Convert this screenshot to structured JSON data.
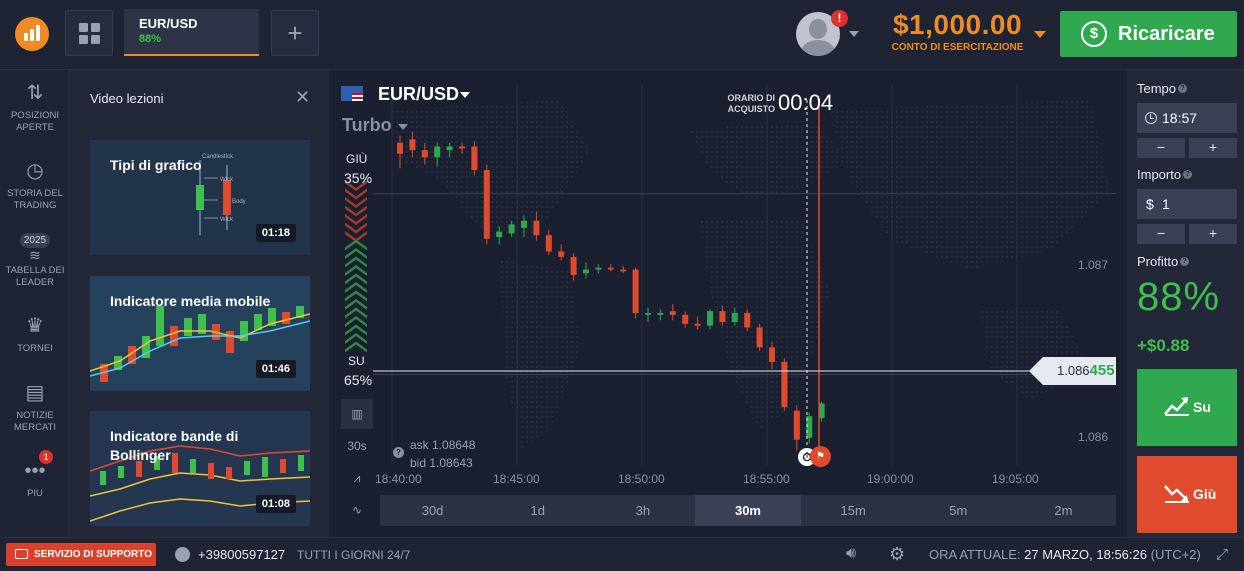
{
  "header": {
    "asset_tab": {
      "name": "EUR/USD",
      "profit": "88%"
    },
    "balance": {
      "amount": "$1,000.00",
      "label": "CONTO DI ESERCITAZIONE"
    },
    "alert_badge": "!",
    "recharge_label": "Ricaricare"
  },
  "sidebar": {
    "items": [
      {
        "label": "POSIZIONI APERTE",
        "icon": "arrows-updown-icon"
      },
      {
        "label": "STORIA DEL TRADING",
        "icon": "history-icon"
      },
      {
        "label": "TABELLA DEI LEADER",
        "icon": "leaderboard-icon",
        "badge": "2025"
      },
      {
        "label": "TORNEI",
        "icon": "trophy-icon"
      },
      {
        "label": "NOTIZIE MERCATI",
        "icon": "news-icon"
      },
      {
        "label": "PIU",
        "icon": "more-icon",
        "badge": "1"
      }
    ]
  },
  "video_panel": {
    "title": "Video lezioni",
    "videos": [
      {
        "title": "Tipi di grafico",
        "duration": "01:18"
      },
      {
        "title": "Indicatore media mobile",
        "duration": "01:46"
      },
      {
        "title": "Indicatore bande di Bollinger",
        "duration": "01:08"
      }
    ],
    "thumb1_labels": {
      "a": "Wick",
      "b": "Body",
      "c": "Wick",
      "d": "Candlestick"
    }
  },
  "chart": {
    "asset": "EUR/USD",
    "mode": "Turbo",
    "purchase_label": "ORARIO DI ACQUISTO",
    "purchase_countdown": "00:04",
    "down_label": "GIÙ",
    "down_pct": "35%",
    "up_label": "SU",
    "up_pct": "65%",
    "current_price_prefix": "1.086",
    "current_price_suffix": "455",
    "y_labels": [
      "1.087",
      "1.086"
    ],
    "ask": "ask 1.08648",
    "bid": "bid 1.08643",
    "x_labels": [
      "18:40:00",
      "18:45:00",
      "18:50:00",
      "18:55:00",
      "19:00:00",
      "19:05:00"
    ],
    "tools": [
      "chart-type-icon",
      "30s",
      "indicators-icon",
      "drawing-icon"
    ],
    "timeframes": [
      "30d",
      "1d",
      "3h",
      "30m",
      "15m",
      "5m",
      "2m"
    ],
    "active_timeframe": "30m"
  },
  "chart_data": {
    "type": "candlestick",
    "title": "",
    "x_labels": [
      "18:40:00",
      "18:45:00",
      "18:50:00",
      "18:55:00",
      "19:00:00",
      "19:05:00"
    ],
    "y_ticks": [
      1.087,
      1.086
    ],
    "current_price": 1.086455,
    "candles_approx": [
      {
        "o": 1.08728,
        "h": 1.08732,
        "l": 1.08714,
        "c": 1.08722
      },
      {
        "o": 1.0873,
        "h": 1.08734,
        "l": 1.0872,
        "c": 1.08724
      },
      {
        "o": 1.08724,
        "h": 1.08728,
        "l": 1.08716,
        "c": 1.0872
      },
      {
        "o": 1.0872,
        "h": 1.08728,
        "l": 1.08715,
        "c": 1.08726
      },
      {
        "o": 1.08724,
        "h": 1.08728,
        "l": 1.0872,
        "c": 1.08726
      },
      {
        "o": 1.08726,
        "h": 1.08728,
        "l": 1.08722,
        "c": 1.08725
      },
      {
        "o": 1.08726,
        "h": 1.08729,
        "l": 1.0871,
        "c": 1.08713
      },
      {
        "o": 1.08713,
        "h": 1.08716,
        "l": 1.08672,
        "c": 1.08675
      },
      {
        "o": 1.08676,
        "h": 1.08682,
        "l": 1.08672,
        "c": 1.08679
      },
      {
        "o": 1.08678,
        "h": 1.08685,
        "l": 1.08676,
        "c": 1.08683
      },
      {
        "o": 1.08681,
        "h": 1.08688,
        "l": 1.08676,
        "c": 1.08685
      },
      {
        "o": 1.08685,
        "h": 1.0869,
        "l": 1.08674,
        "c": 1.08677
      },
      {
        "o": 1.08677,
        "h": 1.0868,
        "l": 1.08666,
        "c": 1.08668
      },
      {
        "o": 1.08668,
        "h": 1.08672,
        "l": 1.08663,
        "c": 1.08665
      },
      {
        "o": 1.08665,
        "h": 1.08667,
        "l": 1.08652,
        "c": 1.08655
      },
      {
        "o": 1.08656,
        "h": 1.08662,
        "l": 1.08653,
        "c": 1.08658
      },
      {
        "o": 1.08658,
        "h": 1.08661,
        "l": 1.08656,
        "c": 1.08659
      },
      {
        "o": 1.08659,
        "h": 1.08661,
        "l": 1.08657,
        "c": 1.08658
      },
      {
        "o": 1.08658,
        "h": 1.0866,
        "l": 1.08656,
        "c": 1.08657
      },
      {
        "o": 1.08658,
        "h": 1.08659,
        "l": 1.08631,
        "c": 1.08634
      },
      {
        "o": 1.08633,
        "h": 1.08637,
        "l": 1.08629,
        "c": 1.08634
      },
      {
        "o": 1.08633,
        "h": 1.08636,
        "l": 1.0863,
        "c": 1.08634
      },
      {
        "o": 1.08635,
        "h": 1.08639,
        "l": 1.0863,
        "c": 1.08633
      },
      {
        "o": 1.08633,
        "h": 1.08635,
        "l": 1.08626,
        "c": 1.08628
      },
      {
        "o": 1.08628,
        "h": 1.08632,
        "l": 1.08625,
        "c": 1.08627
      },
      {
        "o": 1.08627,
        "h": 1.08636,
        "l": 1.08625,
        "c": 1.08635
      },
      {
        "o": 1.08635,
        "h": 1.08638,
        "l": 1.08627,
        "c": 1.08629
      },
      {
        "o": 1.08629,
        "h": 1.08637,
        "l": 1.08627,
        "c": 1.08634
      },
      {
        "o": 1.08634,
        "h": 1.08636,
        "l": 1.08624,
        "c": 1.08626
      },
      {
        "o": 1.08626,
        "h": 1.08628,
        "l": 1.08613,
        "c": 1.08615
      },
      {
        "o": 1.08615,
        "h": 1.08618,
        "l": 1.08603,
        "c": 1.08607
      },
      {
        "o": 1.08607,
        "h": 1.08609,
        "l": 1.0858,
        "c": 1.08582
      },
      {
        "o": 1.0858,
        "h": 1.08583,
        "l": 1.08558,
        "c": 1.08564
      },
      {
        "o": 1.08565,
        "h": 1.08579,
        "l": 1.08562,
        "c": 1.08577
      },
      {
        "o": 1.08576,
        "h": 1.08585,
        "l": 1.08574,
        "c": 1.08584
      }
    ]
  },
  "trade_panel": {
    "time_label": "Tempo",
    "time_value": "18:57",
    "amount_label": "Importo",
    "amount_currency": "$",
    "amount_value": "1",
    "minus": "−",
    "plus": "+",
    "profit_label": "Profitto",
    "profit_pct": "88%",
    "profit_amount": "+$0.88",
    "up_label": "Su",
    "down_label": "Giù"
  },
  "footer": {
    "support_label": "SERVIZIO DI SUPPORTO",
    "phone": "+39800597127",
    "hours": "TUTTI I GIORNI 24/7",
    "current_time_label": "ORA ATTUALE:",
    "current_time": "27 MARZO, 18:56:26",
    "timezone": "(UTC+2)"
  },
  "colors": {
    "accent": "#f08a24",
    "up": "#2fa84f",
    "down": "#e04b2e",
    "bg": "#1b2030"
  }
}
